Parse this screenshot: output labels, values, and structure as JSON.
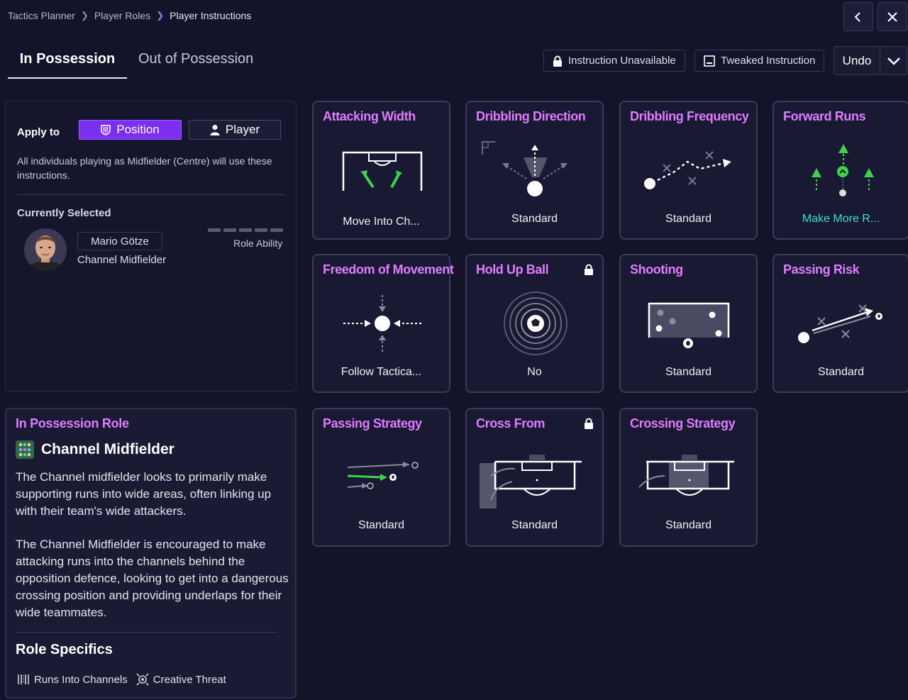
{
  "breadcrumb": [
    "Tactics Planner",
    "Player Roles",
    "Player Instructions"
  ],
  "tabs": {
    "in_possession": "In Possession",
    "out_of_possession": "Out of Possession"
  },
  "toolbar": {
    "unavailable": "Instruction Unavailable",
    "tweaked": "Tweaked Instruction",
    "undo": "Undo"
  },
  "apply": {
    "label": "Apply to",
    "position": "Position",
    "player": "Player",
    "description": "All individuals playing as Midfielder (Centre) will use these instructions.",
    "currently_selected": "Currently Selected",
    "player_name": "Mario Götze",
    "player_role": "Channel Midfielder",
    "role_ability_label": "Role Ability"
  },
  "role": {
    "heading": "In Possession Role",
    "title": "Channel Midfielder",
    "para1": "The Channel midfielder looks to primarily make supporting runs into wide areas, often linking up with their team's wide attackers.",
    "para2": "The Channel Midfielder is encouraged to make attacking runs into the channels behind the opposition defence, looking to get into a dangerous crossing position and providing underlaps for their wide teammates.",
    "specifics_title": "Role Specifics",
    "specifics": [
      "Runs Into Channels",
      "Creative Threat"
    ]
  },
  "cards": [
    {
      "title": "Attacking Width",
      "value": "Move Into Ch...",
      "icon": "attacking-width",
      "locked": false,
      "tweaked": true
    },
    {
      "title": "Dribbling Direction",
      "value": "Standard",
      "icon": "dribbling-direction",
      "locked": false,
      "tweaked": false
    },
    {
      "title": "Dribbling Frequency",
      "value": "Standard",
      "icon": "dribbling-frequency",
      "locked": false,
      "tweaked": false
    },
    {
      "title": "Forward Runs",
      "value": "Make More R...",
      "icon": "forward-runs",
      "locked": false,
      "tweaked": false
    },
    {
      "title": "Freedom of Movement",
      "value": "Follow Tactica...",
      "icon": "freedom-of-movement",
      "locked": false,
      "tweaked": false
    },
    {
      "title": "Hold Up Ball",
      "value": "No",
      "icon": "hold-up-ball",
      "locked": true,
      "tweaked": false
    },
    {
      "title": "Shooting",
      "value": "Standard",
      "icon": "shooting",
      "locked": false,
      "tweaked": false
    },
    {
      "title": "Passing Risk",
      "value": "Standard",
      "icon": "passing-risk",
      "locked": false,
      "tweaked": false
    },
    {
      "title": "Passing Strategy",
      "value": "Standard",
      "icon": "passing-strategy",
      "locked": false,
      "tweaked": false
    },
    {
      "title": "Cross From",
      "value": "Standard",
      "icon": "cross-from",
      "locked": true,
      "tweaked": false
    },
    {
      "title": "Crossing Strategy",
      "value": "Standard",
      "icon": "crossing-strategy",
      "locked": false,
      "tweaked": false
    }
  ],
  "colors": {
    "accent_purple": "#7b2ff0",
    "title_pink": "#e07cff",
    "teal": "#3fe0c8",
    "green": "#3fd34a",
    "background": "#13132a"
  }
}
